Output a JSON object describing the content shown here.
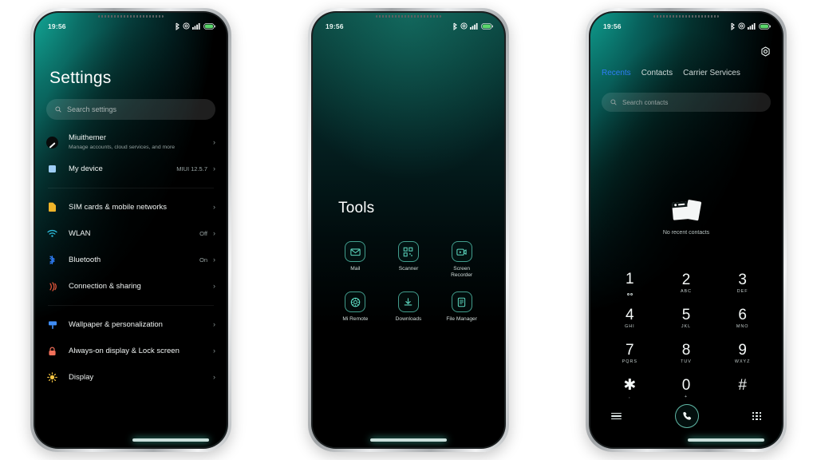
{
  "statusbar": {
    "time": "19:56",
    "icons": [
      "bluetooth-icon",
      "alarm-icon",
      "signal-icon",
      "battery-icon"
    ]
  },
  "phone1": {
    "title": "Settings",
    "search": {
      "placeholder": "Search settings",
      "icon": "search-icon"
    },
    "items": [
      {
        "label": "Miuithemer",
        "sub": "Manage accounts, cloud services, and more",
        "value": "",
        "icon": "account-avatar",
        "color": "#0a0c0c",
        "divider": false
      },
      {
        "label": "My device",
        "sub": "",
        "value": "MIUI 12.5.7",
        "icon": "device-icon",
        "color": "#9ecdf5",
        "divider": true
      },
      {
        "label": "SIM cards & mobile networks",
        "sub": "",
        "value": "",
        "icon": "sim-icon",
        "color": "#f0b429",
        "divider": false
      },
      {
        "label": "WLAN",
        "sub": "",
        "value": "Off",
        "icon": "wifi-icon",
        "color": "#2bb7d6",
        "divider": false
      },
      {
        "label": "Bluetooth",
        "sub": "",
        "value": "On",
        "icon": "bluetooth-icon",
        "color": "#2f7df6",
        "divider": false
      },
      {
        "label": "Connection & sharing",
        "sub": "",
        "value": "",
        "icon": "sharing-icon",
        "color": "#e2553a",
        "divider": true
      },
      {
        "label": "Wallpaper & personalization",
        "sub": "",
        "value": "",
        "icon": "wallpaper-icon",
        "color": "#3f8df5",
        "divider": false
      },
      {
        "label": "Always-on display & Lock screen",
        "sub": "",
        "value": "",
        "icon": "lock-icon",
        "color": "#f2705a",
        "divider": false
      },
      {
        "label": "Display",
        "sub": "",
        "value": "",
        "icon": "brightness-icon",
        "color": "#f5c542",
        "divider": false
      }
    ],
    "chevron": "›"
  },
  "phone2": {
    "title": "Tools",
    "apps": [
      {
        "label": "Mail",
        "icon": "mail-icon"
      },
      {
        "label": "Scanner",
        "icon": "qr-scanner-icon"
      },
      {
        "label": "Screen Recorder",
        "icon": "screen-recorder-icon"
      },
      {
        "label": "Mi Remote",
        "icon": "mi-remote-icon"
      },
      {
        "label": "Downloads",
        "icon": "download-icon"
      },
      {
        "label": "File Manager",
        "icon": "file-manager-icon"
      }
    ]
  },
  "phone3": {
    "gear_icon": "settings-gear-icon",
    "tabs": [
      {
        "label": "Recents",
        "active": true
      },
      {
        "label": "Contacts",
        "active": false
      },
      {
        "label": "Carrier Services",
        "active": false
      }
    ],
    "search": {
      "placeholder": "Search contacts",
      "icon": "search-icon"
    },
    "empty": {
      "text": "No recent contacts",
      "icon": "empty-cards-icon"
    },
    "keys": [
      {
        "num": "1",
        "sub": "",
        "voicemail": true
      },
      {
        "num": "2",
        "sub": "ABC",
        "voicemail": false
      },
      {
        "num": "3",
        "sub": "DEF",
        "voicemail": false
      },
      {
        "num": "4",
        "sub": "GHI",
        "voicemail": false
      },
      {
        "num": "5",
        "sub": "JKL",
        "voicemail": false
      },
      {
        "num": "6",
        "sub": "MNO",
        "voicemail": false
      },
      {
        "num": "7",
        "sub": "PQRS",
        "voicemail": false
      },
      {
        "num": "8",
        "sub": "TUV",
        "voicemail": false
      },
      {
        "num": "9",
        "sub": "WXYZ",
        "voicemail": false
      },
      {
        "num": "✱",
        "sub": ",",
        "voicemail": false
      },
      {
        "num": "0",
        "sub": "+",
        "voicemail": false
      },
      {
        "num": "#",
        "sub": "",
        "voicemail": false
      }
    ],
    "bottom": {
      "menu": "menu-icon",
      "call": "call-icon",
      "dialpad": "dialpad-icon"
    }
  },
  "theme": {
    "accent": "#1fbfa8",
    "blue": "#2f7df6",
    "bg": "#ffffff"
  }
}
